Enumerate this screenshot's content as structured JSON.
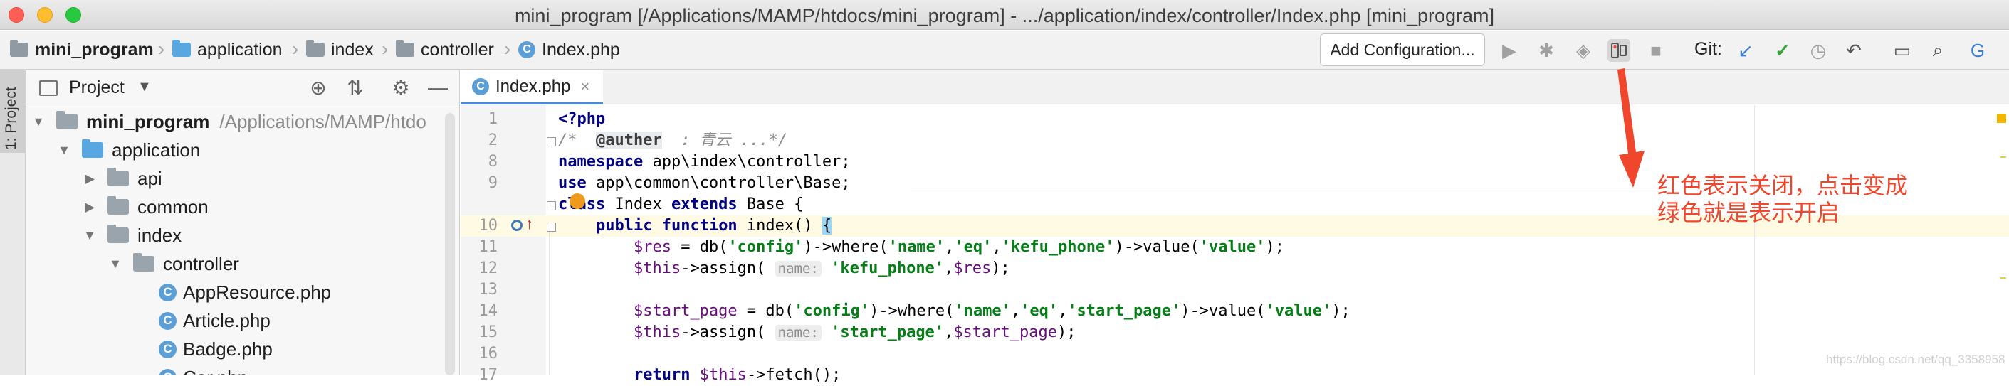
{
  "window": {
    "title": "mini_program [/Applications/MAMP/htdocs/mini_program] - .../application/index/controller/Index.php [mini_program]"
  },
  "breadcrumb": {
    "items": [
      "mini_program",
      "application",
      "index",
      "controller",
      "Index.php"
    ]
  },
  "toolbar": {
    "add_configuration": "Add Configuration...",
    "git_label": "Git:"
  },
  "side_strip": {
    "project_tab": "1: Project"
  },
  "project_panel": {
    "title": "Project",
    "tree": [
      {
        "label": "mini_program",
        "path": "/Applications/MAMP/htdo"
      },
      {
        "label": "application"
      },
      {
        "label": "api"
      },
      {
        "label": "common"
      },
      {
        "label": "index"
      },
      {
        "label": "controller"
      },
      {
        "label": "AppResource.php"
      },
      {
        "label": "Article.php"
      },
      {
        "label": "Badge.php"
      },
      {
        "label": "Car.php"
      }
    ]
  },
  "editor": {
    "tab": "Index.php",
    "line_numbers": [
      "1",
      "2",
      "8",
      "9",
      "10",
      "11",
      "12",
      "13",
      "14",
      "15",
      "16",
      "17"
    ],
    "lines": {
      "l1": "<?php",
      "l2_a": "/*  ",
      "l2_b": "@auther",
      "l2_c": "  : 青云 ...*/",
      "l8_kw": "namespace",
      "l8_rest": " app\\index\\controller;",
      "l9_kw": "use",
      "l9_rest": " app\\common\\controller\\Base;",
      "l10_kw1": "class",
      "l10_mid": " Index ",
      "l10_kw2": "extends",
      "l10_rest": " Base {",
      "l11_kw1": "public",
      "l11_kw2": "function",
      "l11_rest": " index() ",
      "l11_brace": "{",
      "l12_var": "$res",
      "l12_a": " = db(",
      "l12_s1": "'config'",
      "l12_b": ")->where(",
      "l12_s2": "'name'",
      "l12_c": ",",
      "l12_s3": "'eq'",
      "l12_d": ",",
      "l12_s4": "'kefu_phone'",
      "l12_e": ")->value(",
      "l12_s5": "'value'",
      "l12_f": ");",
      "l13_var": "$this",
      "l13_a": "->assign( ",
      "l13_hint": "name:",
      "l13_s1": "'kefu_phone'",
      "l13_b": ",",
      "l13_var2": "$res",
      "l13_c": ");",
      "l15_var": "$start_page",
      "l15_a": " = db(",
      "l15_s1": "'config'",
      "l15_b": ")->where(",
      "l15_s2": "'name'",
      "l15_c": ",",
      "l15_s3": "'eq'",
      "l15_d": ",",
      "l15_s4": "'start_page'",
      "l15_e": ")->value(",
      "l15_s5": "'value'",
      "l15_f": ");",
      "l16_var": "$this",
      "l16_a": "->assign( ",
      "l16_hint": "name:",
      "l16_s1": "'start_page'",
      "l16_b": ",",
      "l16_var2": "$start_page",
      "l16_c": ");",
      "l17_kw": "return",
      "l17_var": "$this",
      "l17_rest": "->fetch();"
    }
  },
  "annotation": {
    "line1": "红色表示关闭，点击变成",
    "line2": "绿色就是表示开启"
  },
  "watermark": "https://blog.csdn.net/qq_3358958",
  "colors": {
    "annotation": "#f0462c",
    "keyword": "#000080",
    "string": "#067d17",
    "variable": "#660e7a"
  }
}
